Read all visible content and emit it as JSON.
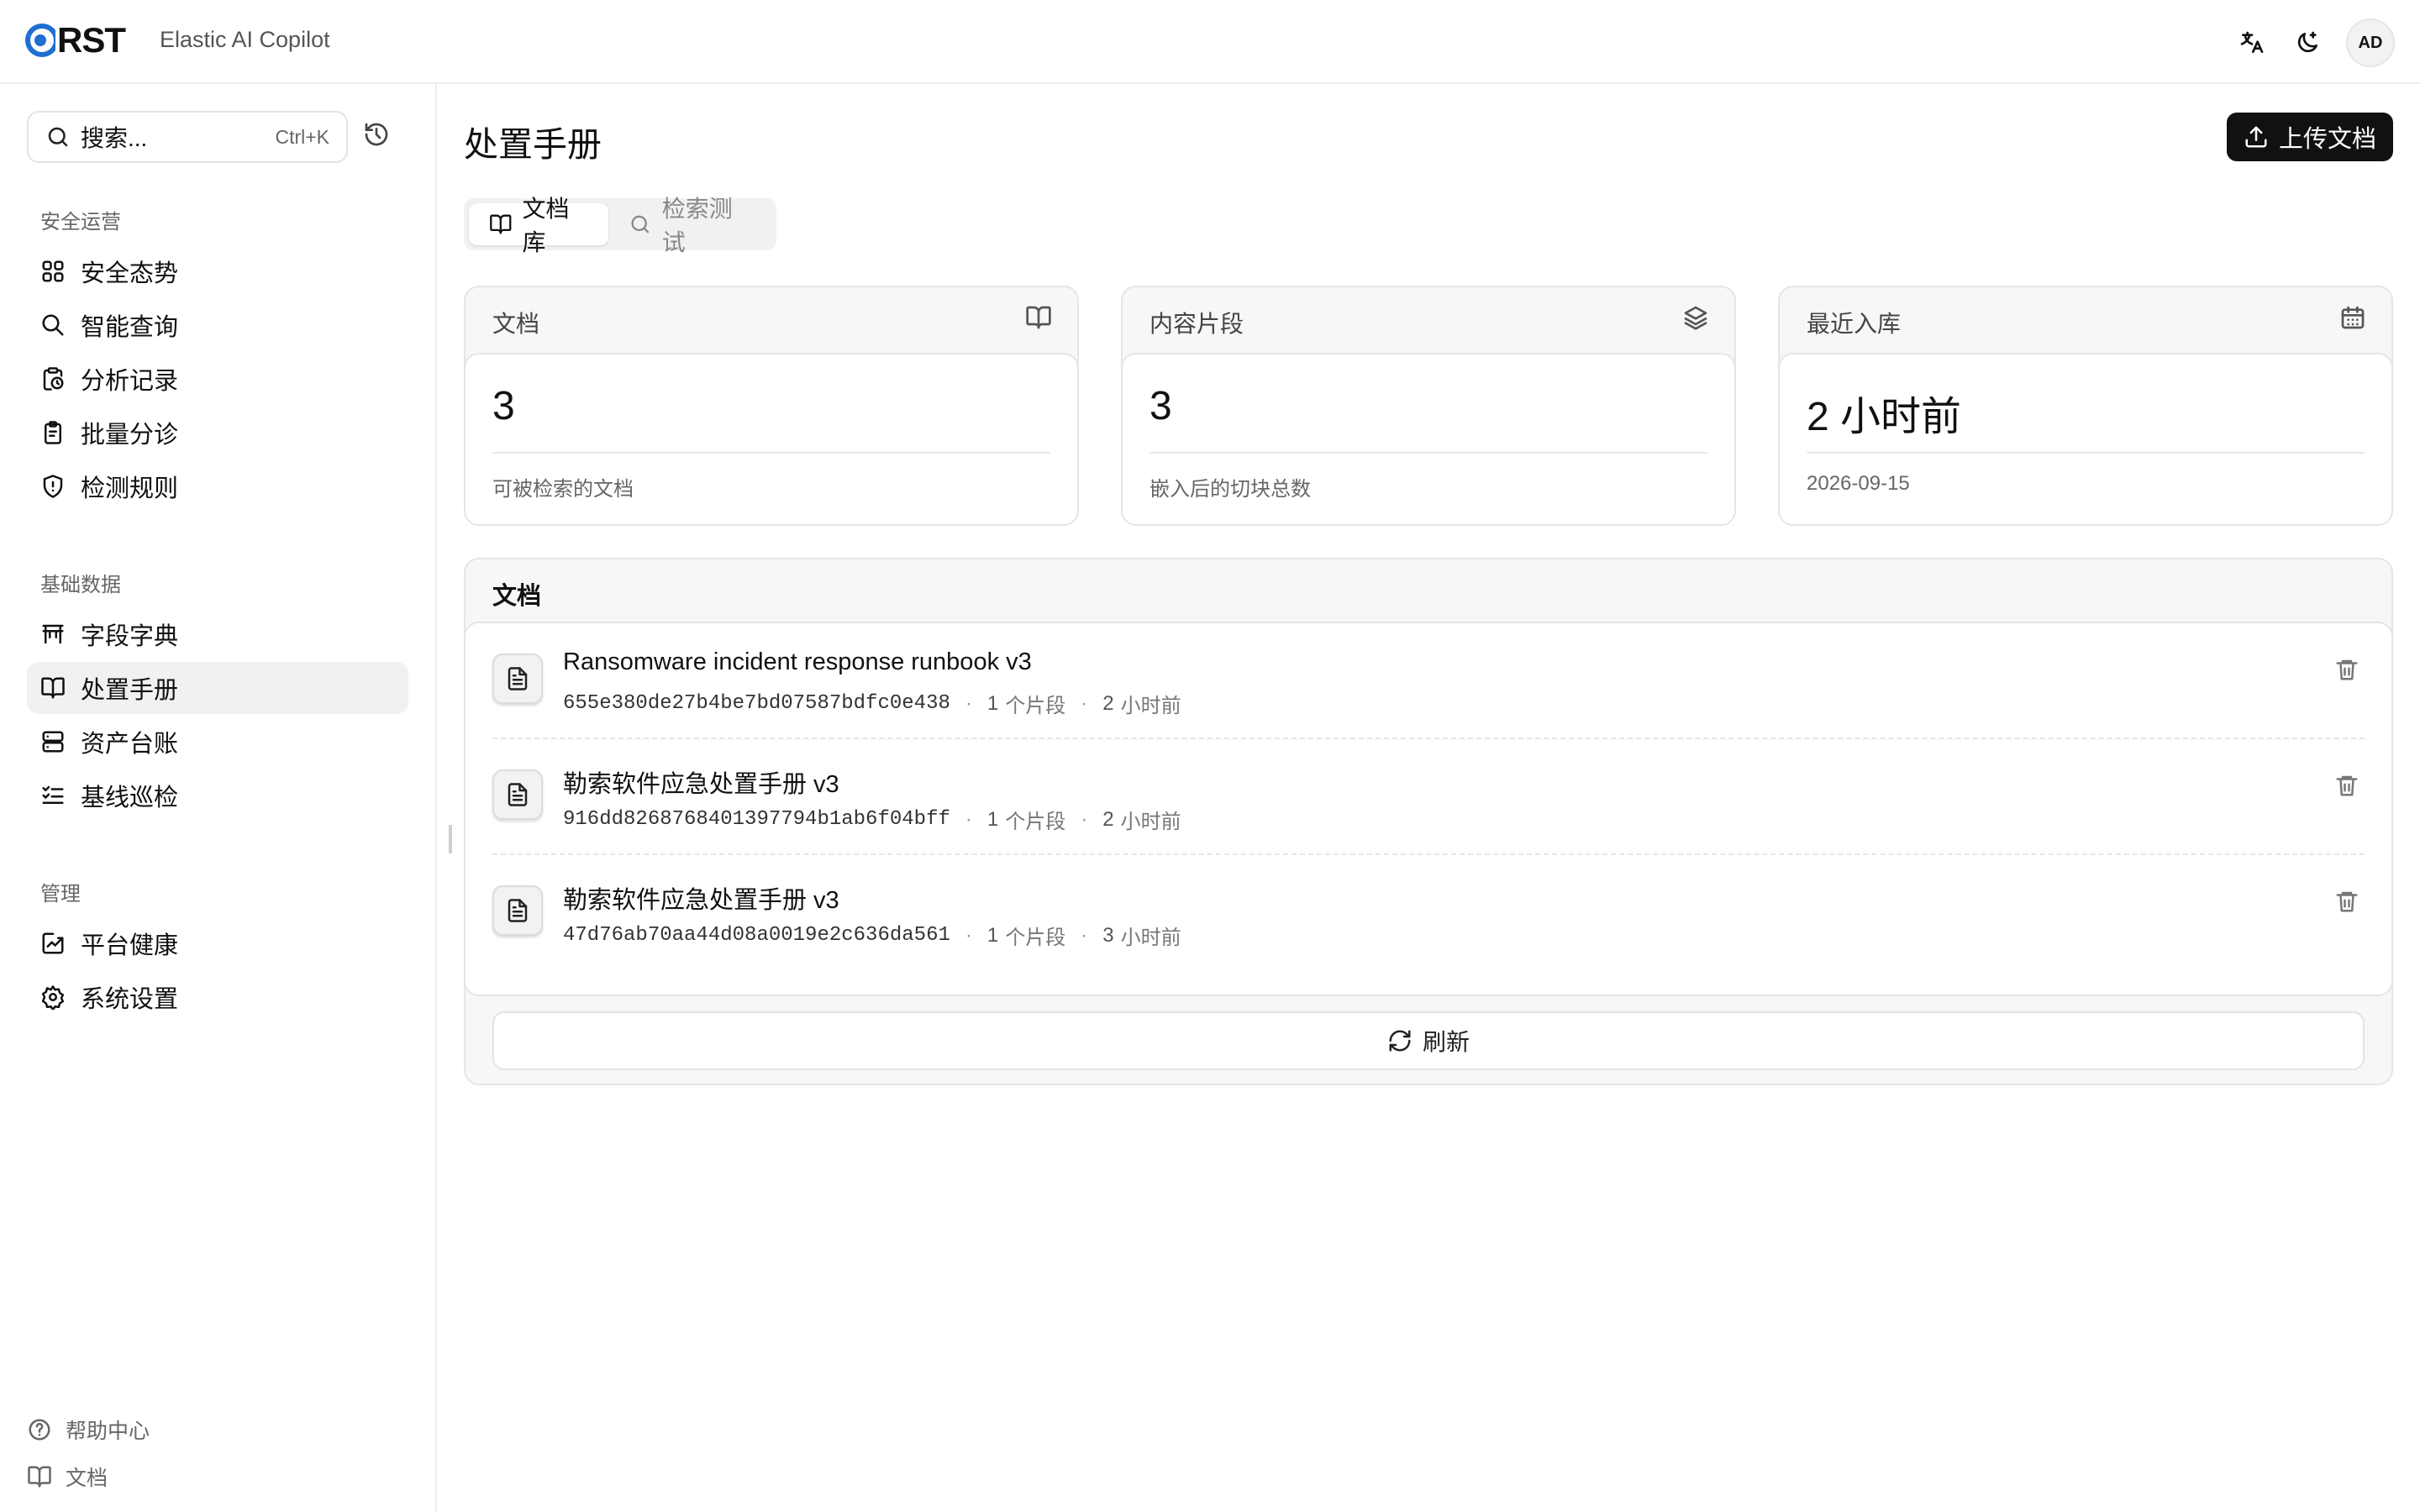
{
  "header": {
    "logo_text": "RST",
    "app_name": "Elastic AI Copilot",
    "avatar": "AD",
    "icons": [
      "translate-icon",
      "theme-toggle-icon"
    ]
  },
  "sidebar": {
    "search_placeholder": "搜索...",
    "search_shortcut": "Ctrl+K",
    "sections": [
      {
        "label": "安全运营",
        "items": [
          {
            "label": "安全态势",
            "icon": "dashboard-icon"
          },
          {
            "label": "智能查询",
            "icon": "search-icon"
          },
          {
            "label": "分析记录",
            "icon": "history-record-icon"
          },
          {
            "label": "批量分诊",
            "icon": "clipboard-icon"
          },
          {
            "label": "检测规则",
            "icon": "shield-alert-icon"
          }
        ]
      },
      {
        "label": "基础数据",
        "items": [
          {
            "label": "字段字典",
            "icon": "table-icon"
          },
          {
            "label": "处置手册",
            "icon": "book-icon",
            "active": true
          },
          {
            "label": "资产台账",
            "icon": "server-icon"
          },
          {
            "label": "基线巡检",
            "icon": "checklist-icon"
          }
        ]
      },
      {
        "label": "管理",
        "items": [
          {
            "label": "平台健康",
            "icon": "activity-icon"
          },
          {
            "label": "系统设置",
            "icon": "gear-icon"
          }
        ]
      }
    ],
    "footer": [
      {
        "label": "帮助中心",
        "icon": "help-icon"
      },
      {
        "label": "文档",
        "icon": "book-icon"
      }
    ]
  },
  "main": {
    "title": "处置手册",
    "upload_label": "上传文档",
    "tabs": [
      {
        "label": "文档库",
        "active": true
      },
      {
        "label": "检索测试",
        "active": false
      }
    ],
    "stats": [
      {
        "title": "文档",
        "value": "3",
        "sub": "可被检索的文档",
        "icon": "book-icon"
      },
      {
        "title": "内容片段",
        "value": "3",
        "sub": "嵌入后的切块总数",
        "icon": "layers-icon"
      },
      {
        "title": "最近入库",
        "value": "2 小时前",
        "sub": "2026-09-15",
        "icon": "calendar-icon"
      }
    ],
    "docs": {
      "title": "文档",
      "rows": [
        {
          "name": "Ransomware incident response runbook v3",
          "hash": "655e380de27b4be7bd07587bdfc0e438",
          "chunks": "1",
          "chunks_unit": "个片段",
          "age": "2",
          "age_unit": "小时前"
        },
        {
          "name": "勒索软件应急处置手册 v3",
          "hash": "916dd8268768401397794b1ab6f04bff",
          "chunks": "1",
          "chunks_unit": "个片段",
          "age": "2",
          "age_unit": "小时前"
        },
        {
          "name": "勒索软件应急处置手册 v3",
          "hash": "47d76ab70aa44d08a0019e2c636da561",
          "chunks": "1",
          "chunks_unit": "个片段",
          "age": "3",
          "age_unit": "小时前"
        }
      ]
    },
    "refresh_label": "刷新"
  },
  "colors": {
    "accent": "#1f6fd1",
    "primary_button": "#111111",
    "active_nav": "#f1f1f1"
  }
}
